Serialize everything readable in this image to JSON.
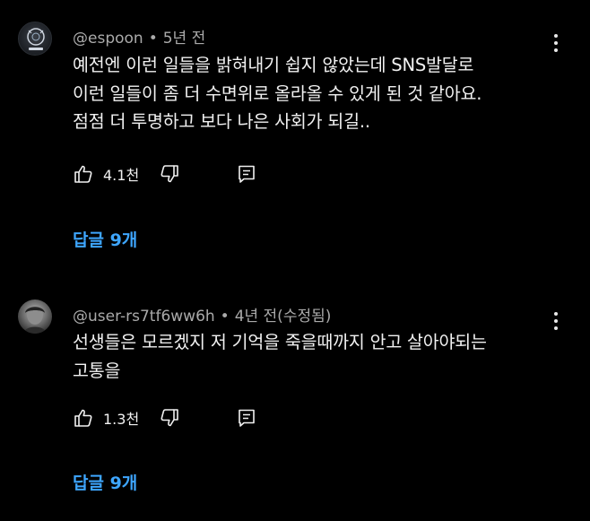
{
  "colors": {
    "background": "#000000",
    "text": "#f1f1f1",
    "meta": "#aaaaaa",
    "link": "#3ea6ff"
  },
  "comments": [
    {
      "handle": "@espoon",
      "separator": "•",
      "time": "5년 전",
      "lines": [
        "예전엔 이런 일들을 밝혀내기 쉽지 않았는데 SNS발달로",
        "이런 일들이 좀 더 수면위로 올라올 수 있게 된 것 같아요.",
        "점점 더 투명하고 보다 나은 사회가 되길.."
      ],
      "likes": "4.1천",
      "replies_label": "답글 9개",
      "icons": {
        "avatar": "avatar",
        "menu": "more-vert-icon",
        "like": "thumb-up-icon",
        "dislike": "thumb-down-icon",
        "reply": "comment-icon"
      }
    },
    {
      "handle": "@user-rs7tf6ww6h",
      "separator": "•",
      "time": "4년 전(수정됨)",
      "lines": [
        "선생들은 모르겠지 저 기억을 죽을때까지 안고 살아야되는",
        "고통을"
      ],
      "likes": "1.3천",
      "replies_label": "답글 9개",
      "icons": {
        "avatar": "avatar",
        "menu": "more-vert-icon",
        "like": "thumb-up-icon",
        "dislike": "thumb-down-icon",
        "reply": "comment-icon"
      }
    }
  ]
}
